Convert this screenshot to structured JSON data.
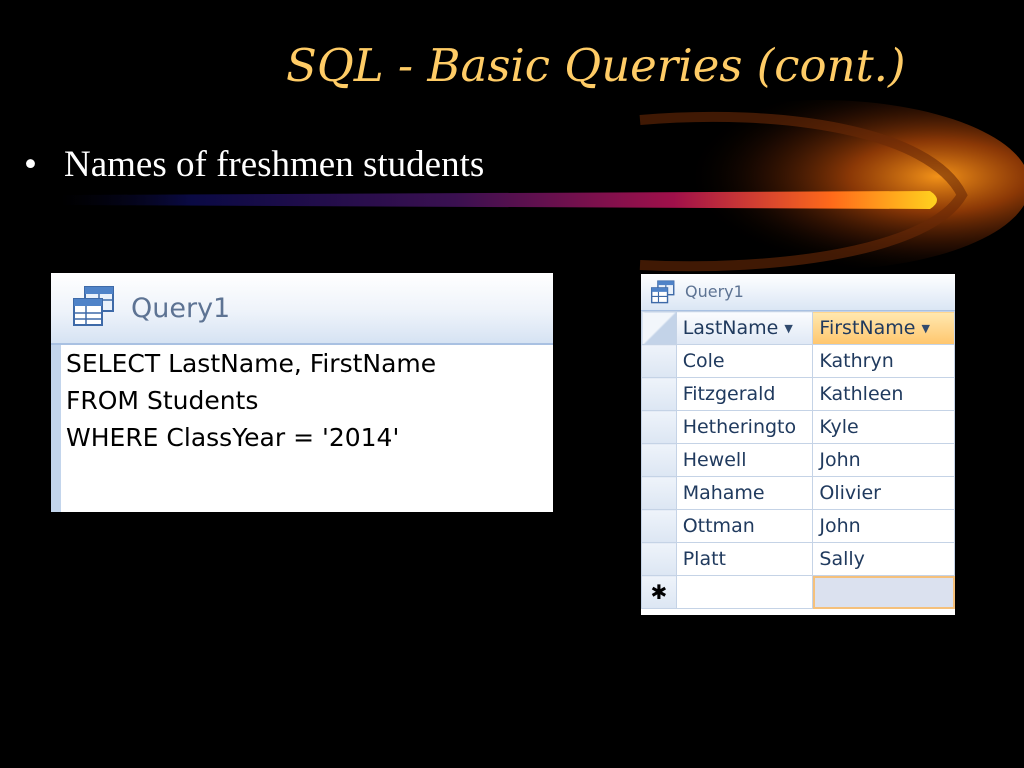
{
  "slide": {
    "title": "SQL - Basic Queries (cont.)",
    "bullet_symbol": "•",
    "bullet_text": "Names of freshmen students",
    "title_color": "#ffcc66",
    "background_color": "#000000"
  },
  "sql_view": {
    "tab_label": "Query1",
    "tab_icon": "query-table-icon",
    "lines": [
      "SELECT LastName, FirstName",
      "FROM Students",
      "WHERE ClassYear = '2014'"
    ]
  },
  "datasheet": {
    "tab_label": "Query1",
    "tab_icon": "query-table-icon",
    "columns": [
      {
        "label": "LastName",
        "sort_icon": "dropdown-arrow-icon"
      },
      {
        "label": "FirstName",
        "sort_icon": "dropdown-arrow-icon"
      }
    ],
    "rows": [
      {
        "last": "Cole",
        "first": "Kathryn"
      },
      {
        "last": "Fitzgerald",
        "first": "Kathleen"
      },
      {
        "last": "Hetheringto",
        "first": "Kyle"
      },
      {
        "last": "Hewell",
        "first": "John"
      },
      {
        "last": "Mahame",
        "first": "Olivier"
      },
      {
        "last": "Ottman",
        "first": "John"
      },
      {
        "last": "Platt",
        "first": "Sally"
      }
    ],
    "new_row_marker": "✱"
  }
}
